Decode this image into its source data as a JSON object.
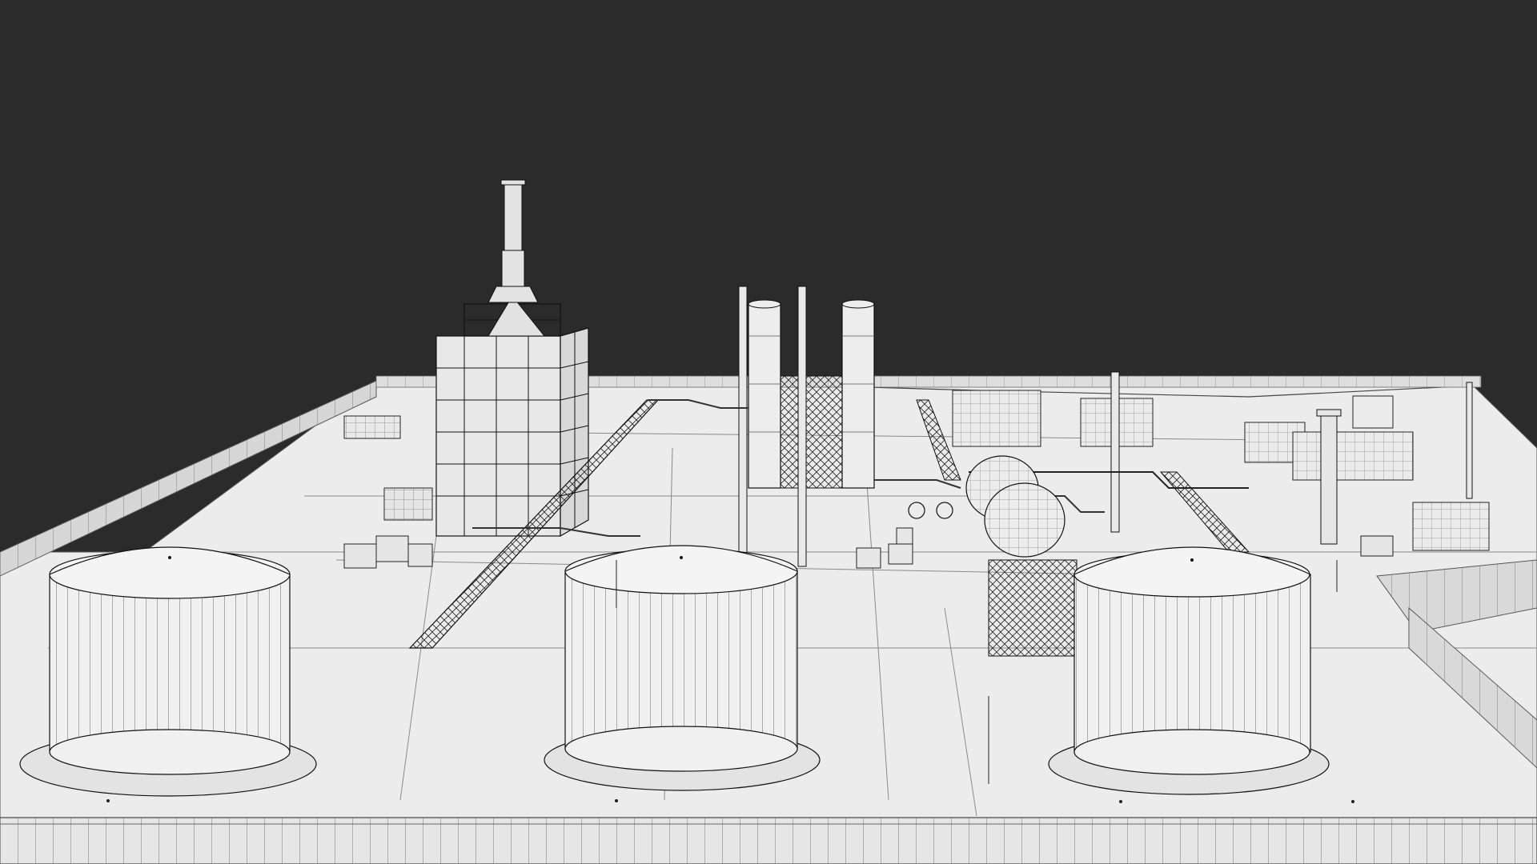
{
  "colors": {
    "background": "#2b2b2b",
    "surface": "#efefef",
    "surface_shade": "#dcdcdc",
    "line": "#1f1f1f",
    "line_light": "#5a5a5a"
  }
}
